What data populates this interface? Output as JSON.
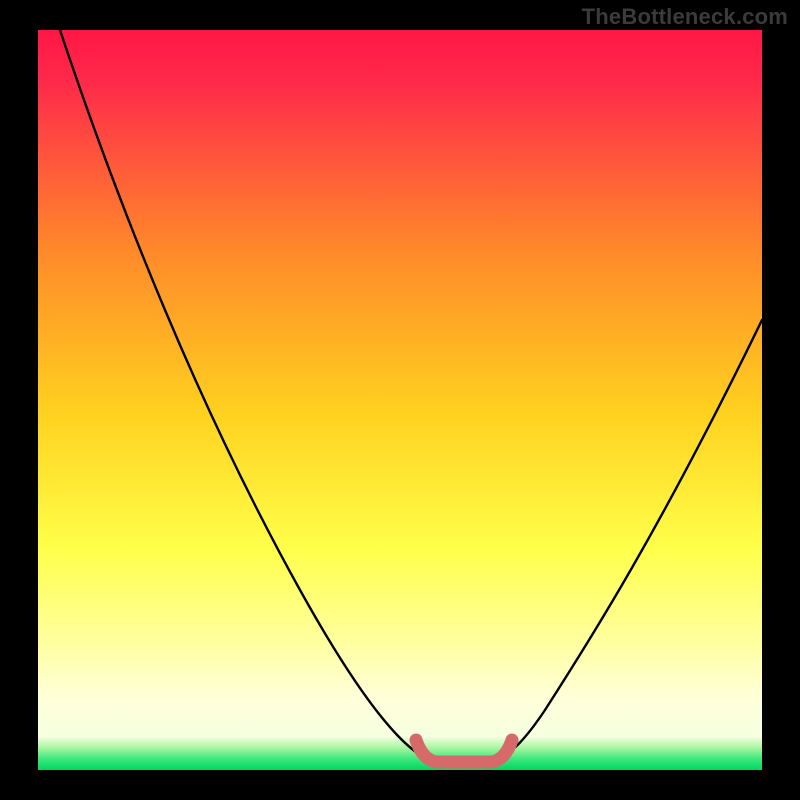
{
  "watermark": "TheBottleneck.com",
  "colors": {
    "frame": "#000000",
    "grad_top": "#ff1745",
    "grad_upper_mid": "#ff8a2a",
    "grad_mid": "#ffd21f",
    "grad_lower_mid": "#ffff6a",
    "grad_pale": "#ffffd0",
    "grad_bottom": "#00e06a",
    "curve": "#000000",
    "marker": "#d66a6a"
  },
  "chart_data": {
    "type": "line",
    "title": "",
    "xlabel": "",
    "ylabel": "",
    "xlim": [
      0,
      100
    ],
    "ylim": [
      0,
      100
    ],
    "series": [
      {
        "name": "bottleneck-curve",
        "x": [
          3,
          10,
          20,
          30,
          40,
          48,
          53,
          55,
          58,
          61,
          63,
          65,
          70,
          80,
          90,
          100
        ],
        "values": [
          100,
          82,
          62,
          43,
          26,
          10,
          2,
          0.5,
          0.5,
          1,
          2,
          5,
          13,
          30,
          47,
          62
        ]
      },
      {
        "name": "optimal-band",
        "x": [
          52,
          54,
          56,
          58,
          60,
          62,
          64
        ],
        "values": [
          2.5,
          1.0,
          0.6,
          0.6,
          0.8,
          1.5,
          3.0
        ]
      }
    ],
    "optimal_range_x": [
      52,
      64
    ]
  }
}
